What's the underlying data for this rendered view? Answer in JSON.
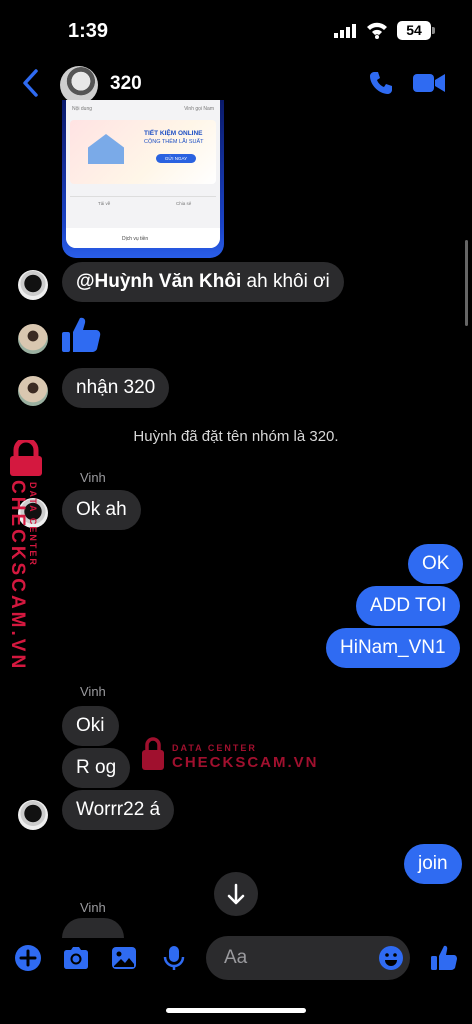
{
  "status": {
    "time": "1:39",
    "battery": "54"
  },
  "header": {
    "title": "320"
  },
  "shared_image": {
    "top_left": "Nội dung",
    "top_right": "Vinh gọi Nam",
    "headline": "TIẾT KIỆM ONLINE",
    "subheadline": "CỘNG THÊM LÃI SUẤT",
    "cta": "GỬI NGAY",
    "action_left": "Tải về",
    "action_right": "Chia sẻ",
    "bottom": "Dịch vụ tiền"
  },
  "messages": {
    "m1_mention": "@Huỳnh Văn Khôi",
    "m1_text": " ah khôi ơi",
    "m3": "nhận 320",
    "system": "Huỳnh đã đặt tên nhóm là 320.",
    "sender_1": "Vinh",
    "m4": "Ok ah",
    "out_1": "OK",
    "out_2": "ADD TOI",
    "out_3": "HiNam_VN1",
    "sender_2": "Vinh",
    "m5": "Oki",
    "m6": "R og",
    "m7": "Worrr22 á",
    "out_4": "join",
    "sender_3": "Vinh"
  },
  "watermark": {
    "big": "CHECKSCAM.VN",
    "small": "DATA CENTER"
  },
  "composer": {
    "placeholder": "Aa"
  },
  "colors": {
    "accent": "#2f6bf2",
    "incoming": "#2b2b2d",
    "watermark": "#d4183f"
  }
}
